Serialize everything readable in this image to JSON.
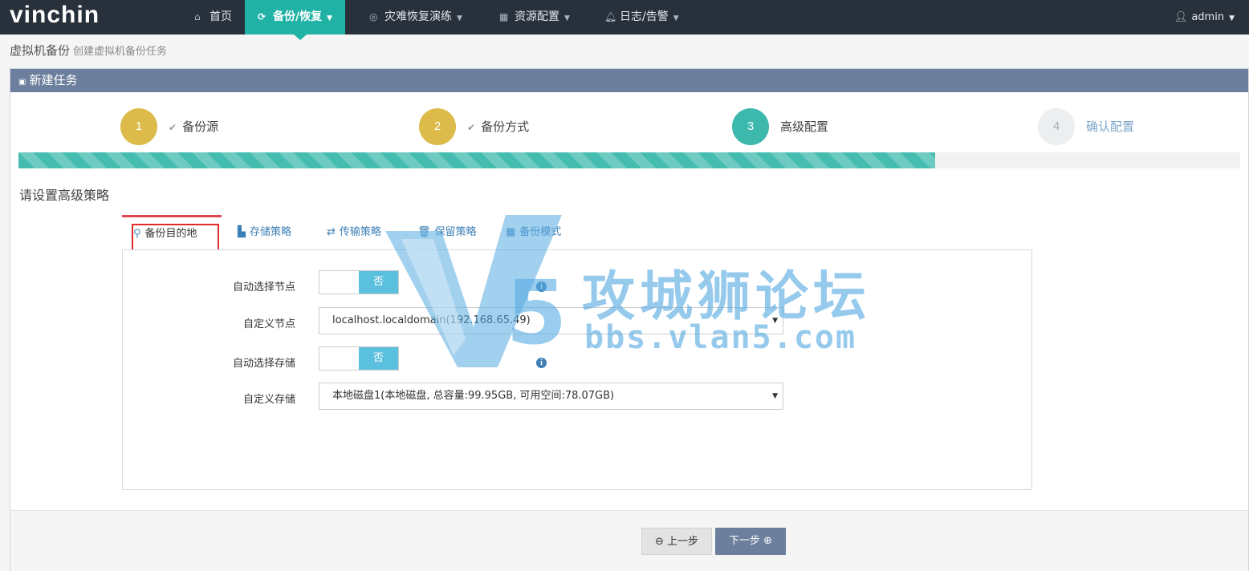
{
  "app": {
    "logo": "vinchin"
  },
  "nav": {
    "items": [
      {
        "label": "首页",
        "icon": "home-icon"
      },
      {
        "label": "备份/恢复",
        "icon": "refresh-icon",
        "active": true
      },
      {
        "label": "灾难恢复演练",
        "icon": "target-icon"
      },
      {
        "label": "资源配置",
        "icon": "grid-icon"
      },
      {
        "label": "日志/告警",
        "icon": "bell-icon"
      }
    ],
    "user": "admin"
  },
  "breadcrumb": {
    "title": "虚拟机备份",
    "subtitle": "创建虚拟机备份任务"
  },
  "panel": {
    "title": "新建任务"
  },
  "steps": [
    {
      "number": "1",
      "label": "备份源",
      "status": "done"
    },
    {
      "number": "2",
      "label": "备份方式",
      "status": "done"
    },
    {
      "number": "3",
      "label": "高级配置",
      "status": "current"
    },
    {
      "number": "4",
      "label": "确认配置",
      "status": "todo"
    }
  ],
  "progress": {
    "percent": 75
  },
  "section_title": "请设置高级策略",
  "tabs": [
    {
      "label": "备份目的地",
      "icon": "location-pin-icon",
      "active": true
    },
    {
      "label": "存储策略",
      "icon": "storage-icon"
    },
    {
      "label": "传输策略",
      "icon": "transfer-icon"
    },
    {
      "label": "保留策略",
      "icon": "trash-icon"
    },
    {
      "label": "备份模式",
      "icon": "grid-icon"
    }
  ],
  "form": {
    "auto_node_label": "自动选择节点",
    "auto_node_value": "否",
    "custom_node_label": "自定义节点",
    "custom_node_value": "localhost.localdomain(192.168.65.49)",
    "auto_storage_label": "自动选择存储",
    "auto_storage_value": "否",
    "custom_storage_label": "自定义存储",
    "custom_storage_value": "本地磁盘1(本地磁盘, 总容量:99.95GB, 可用空间:78.07GB)"
  },
  "buttons": {
    "prev": "上一步",
    "next": "下一步"
  },
  "watermark": {
    "cn": "攻城狮论坛",
    "en": "bbs.vlan5.com"
  },
  "colors": {
    "navbar": "#27303b",
    "accent": "#20b2a4",
    "step_done": "#dcbb4a",
    "step_current": "#3db8ad",
    "panel_header": "#6c7f9d",
    "toggle": "#5bc0de",
    "highlight": "#e02a2a"
  }
}
